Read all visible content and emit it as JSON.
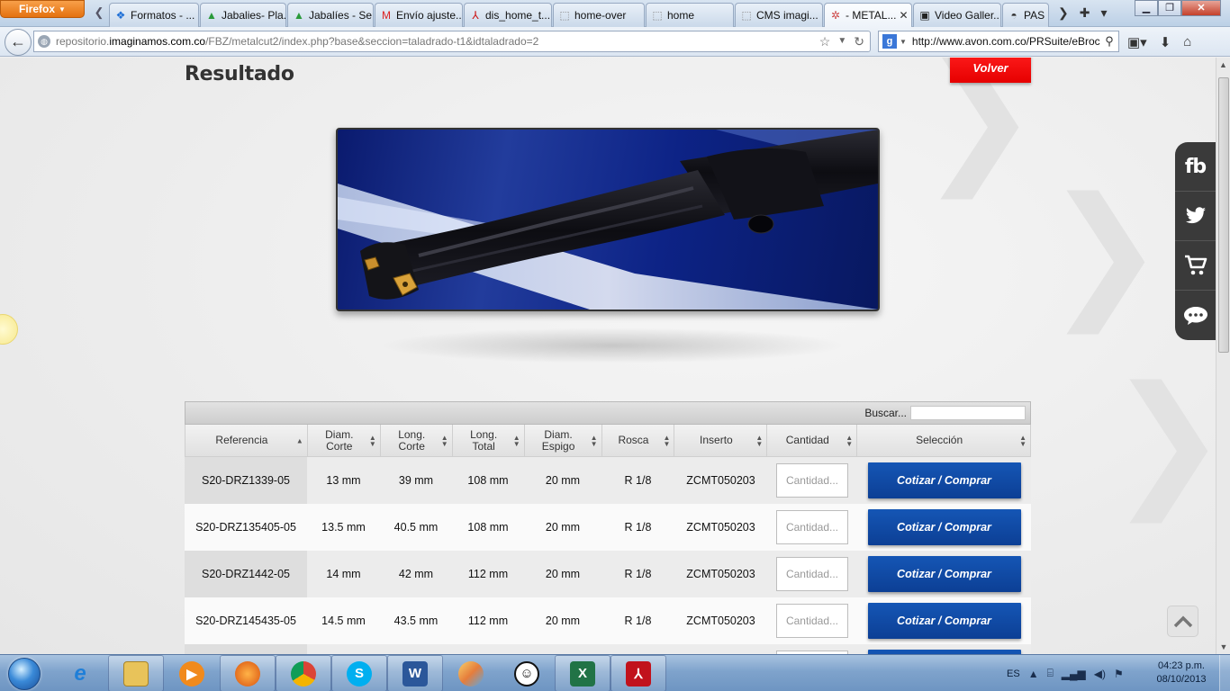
{
  "browser": {
    "menu_button": "Firefox",
    "tabs": [
      {
        "label": "Formatos - ...",
        "icon": "dropbox-icon",
        "active": false
      },
      {
        "label": "Jabalies- Pla...",
        "icon": "drive-icon",
        "active": false
      },
      {
        "label": "Jabalíes - Se...",
        "icon": "drive-icon",
        "active": false
      },
      {
        "label": "Envío ajuste...",
        "icon": "gmail-icon",
        "active": false
      },
      {
        "label": "dis_home_t...",
        "icon": "pdf-icon",
        "active": false
      },
      {
        "label": "home-over",
        "icon": "page-icon",
        "active": false
      },
      {
        "label": "home",
        "icon": "page-icon",
        "active": false
      },
      {
        "label": "CMS imagi...",
        "icon": "page-icon",
        "active": false
      },
      {
        "label": "- METAL...",
        "icon": "metal-icon",
        "active": true
      },
      {
        "label": "Video Galler...",
        "icon": "video-icon",
        "active": false
      },
      {
        "label": "PAS",
        "icon": "pas-icon",
        "active": false
      }
    ],
    "url_domain_pre": "repositorio.",
    "url_domain": "imaginamos.com.co",
    "url_path": "/FBZ/metalcut2/index.php?base&seccion=taladrado-t1&idtaladrado=2",
    "search_text": "http://www.avon.com.co/PRSuite/eBroc"
  },
  "page": {
    "title": "Resultado",
    "back_button": "Volver",
    "search_label": "Buscar...",
    "columns": [
      "Referencia",
      "Diam. Corte",
      "Long. Corte",
      "Long. Total",
      "Diam. Espigo",
      "Rosca",
      "Inserto",
      "Cantidad",
      "Selección"
    ],
    "rows": [
      {
        "ref": "S20-DRZ1339-05",
        "diam_corte": "13 mm",
        "long_corte": "39 mm",
        "long_total": "108 mm",
        "diam_espigo": "20 mm",
        "rosca": "R 1/8",
        "inserto": "ZCMT050203",
        "cantidad_placeholder": "Cantidad...",
        "button": "Cotizar / Comprar"
      },
      {
        "ref": "S20-DRZ135405-05",
        "diam_corte": "13.5 mm",
        "long_corte": "40.5 mm",
        "long_total": "108 mm",
        "diam_espigo": "20 mm",
        "rosca": "R 1/8",
        "inserto": "ZCMT050203",
        "cantidad_placeholder": "Cantidad...",
        "button": "Cotizar / Comprar"
      },
      {
        "ref": "S20-DRZ1442-05",
        "diam_corte": "14 mm",
        "long_corte": "42 mm",
        "long_total": "112 mm",
        "diam_espigo": "20 mm",
        "rosca": "R 1/8",
        "inserto": "ZCMT050203",
        "cantidad_placeholder": "Cantidad...",
        "button": "Cotizar / Comprar"
      },
      {
        "ref": "S20-DRZ145435-05",
        "diam_corte": "14.5 mm",
        "long_corte": "43.5 mm",
        "long_total": "112 mm",
        "diam_espigo": "20 mm",
        "rosca": "R 1/8",
        "inserto": "ZCMT050203",
        "cantidad_placeholder": "Cantidad...",
        "button": "Cotizar / Comprar"
      }
    ],
    "social": [
      {
        "name": "facebook",
        "label": "fb"
      },
      {
        "name": "twitter",
        "icon": "twitter-bird-icon"
      },
      {
        "name": "cart",
        "icon": "cart-icon"
      },
      {
        "name": "chat",
        "icon": "chat-icon"
      }
    ]
  },
  "taskbar": {
    "language": "ES",
    "time": "04:23 p.m.",
    "date": "08/10/2013",
    "apps": [
      "internet-explorer-icon",
      "file-explorer-icon",
      "media-player-icon",
      "firefox-icon",
      "chrome-icon",
      "skype-icon",
      "word-icon",
      "paint-icon",
      "smiley-icon",
      "excel-icon",
      "acrobat-icon"
    ]
  },
  "colors": {
    "accent_red": "#ff0000",
    "button_blue": "#0e4aa6",
    "social_bg": "#3a3a3a"
  }
}
